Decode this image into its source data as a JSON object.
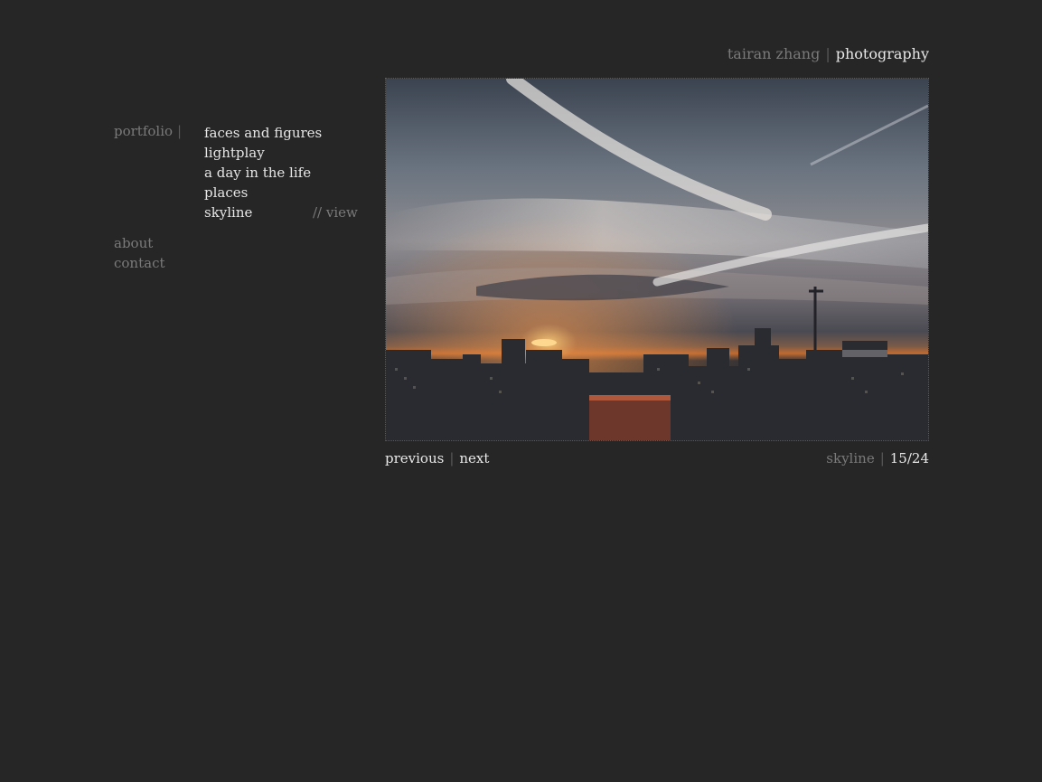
{
  "header": {
    "name": "tairan zhang",
    "section": "photography"
  },
  "nav": {
    "portfolio_label": "portfolio",
    "separator": "|",
    "galleries": [
      {
        "label": "faces and figures"
      },
      {
        "label": "lightplay"
      },
      {
        "label": "a day in the life"
      },
      {
        "label": "places"
      },
      {
        "label": "skyline"
      }
    ],
    "view_label": "// view",
    "secondary": [
      {
        "label": "about"
      },
      {
        "label": "contact"
      }
    ]
  },
  "photo": {
    "subject": "city skyline at sunset under streaked clouds"
  },
  "pager": {
    "previous_label": "previous",
    "separator": "|",
    "next_label": "next",
    "gallery_name": "skyline",
    "position": "15/24"
  },
  "colors": {
    "background": "#262626",
    "muted_text": "#7a7a7a",
    "light_text": "#e6e6e6"
  }
}
